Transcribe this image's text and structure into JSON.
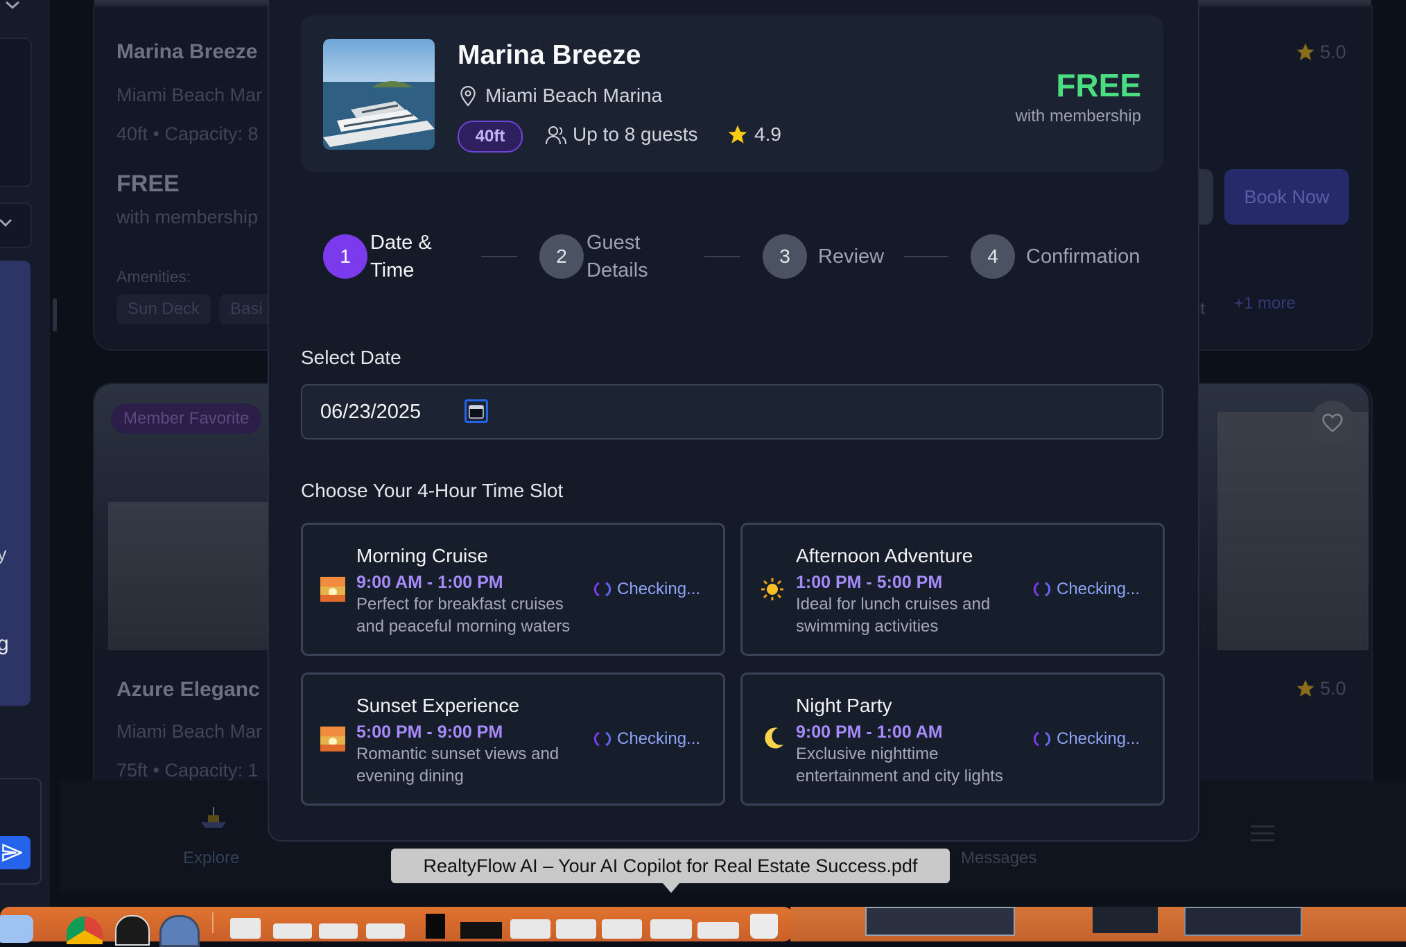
{
  "background": {
    "card1": {
      "title": "Marina Breeze",
      "location": "Miami Beach Mar",
      "specs": "40ft • Capacity: 8",
      "rating": "5.0",
      "price": "FREE",
      "price_note": "with membership",
      "book_label": "Book Now",
      "amenities_label": "Amenities:",
      "amenities": [
        "Sun Deck",
        "Basi"
      ],
      "amenity_tail": "nt",
      "more_label": "+1 more"
    },
    "card2": {
      "badge": "Member Favorite",
      "title": "Azure Eleganc",
      "location": "Miami Beach Mar",
      "specs": "75ft • Capacity: 1",
      "rating": "5.0"
    },
    "left_edge_text": {
      "a": "y",
      "b": "g"
    },
    "nav": {
      "explore": "Explore",
      "messages": "Messages"
    }
  },
  "boat": {
    "name": "Marina Breeze",
    "location": "Miami Beach Marina",
    "length_badge": "40ft",
    "guests": "Up to 8 guests",
    "rating": "4.9",
    "price": "FREE",
    "price_note": "with membership"
  },
  "steps": [
    {
      "number": "1",
      "label_line1": "Date &",
      "label_line2": "Time",
      "active": true
    },
    {
      "number": "2",
      "label_line1": "Guest",
      "label_line2": "Details",
      "active": false
    },
    {
      "number": "3",
      "label": "Review",
      "active": false
    },
    {
      "number": "4",
      "label": "Confirmation",
      "active": false
    }
  ],
  "date_section": {
    "label": "Select Date",
    "value": "06/23/2025"
  },
  "slots_section": {
    "label": "Choose Your 4-Hour Time Slot",
    "status_text": "Checking...",
    "slots": [
      {
        "icon": "sunrise-icon",
        "title": "Morning Cruise",
        "time": "9:00 AM - 1:00 PM",
        "desc_line1": "Perfect for breakfast cruises",
        "desc_line2": "and peaceful morning waters"
      },
      {
        "icon": "sun-icon",
        "title": "Afternoon Adventure",
        "time": "1:00 PM - 5:00 PM",
        "desc_line1": "Ideal for lunch cruises and",
        "desc_line2": "swimming activities"
      },
      {
        "icon": "sunset-icon",
        "title": "Sunset Experience",
        "time": "5:00 PM - 9:00 PM",
        "desc_line1": "Romantic sunset views and",
        "desc_line2": "evening dining"
      },
      {
        "icon": "moon-icon",
        "title": "Night Party",
        "time": "9:00 PM - 1:00 AM",
        "desc_line1": "Exclusive nighttime",
        "desc_line2": "entertainment and city lights"
      }
    ]
  },
  "tooltip": {
    "text": "RealtyFlow AI – Your AI Copilot for Real Estate Success.pdf"
  },
  "colors": {
    "accent_purple": "#7c3aed",
    "price_green": "#4ade80",
    "slot_time": "#a78bfa",
    "checking_blue": "#8ea4f6"
  }
}
